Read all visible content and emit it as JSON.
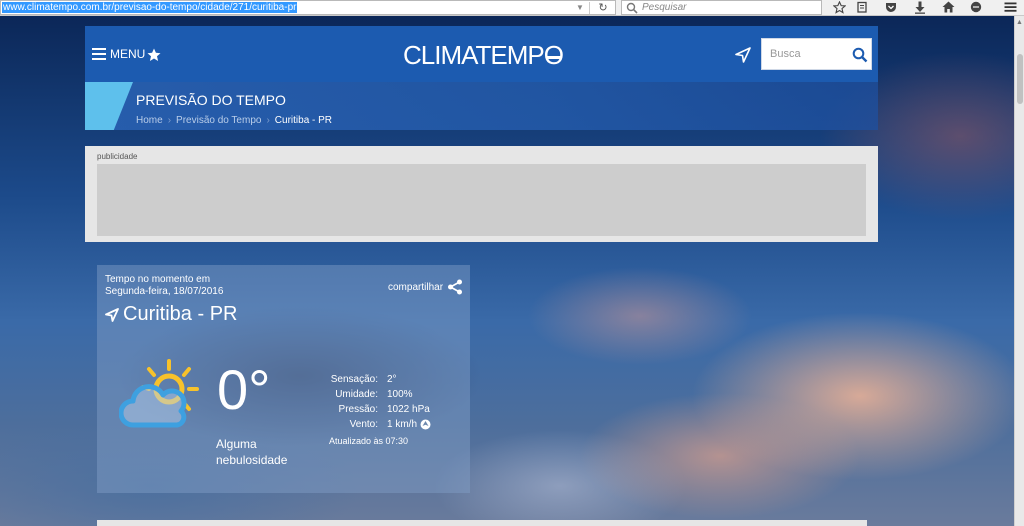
{
  "browser": {
    "url": "www.climatempo.com.br/previsao-do-tempo/cidade/271/curitiba-pr",
    "search_placeholder": "Pesquisar"
  },
  "header": {
    "menu_label": "MENU",
    "logo_text": "CLIMATEMPO",
    "search_placeholder": "Busca"
  },
  "title_band": {
    "title": "PREVISÃO DO TEMPO",
    "breadcrumb": [
      "Home",
      "Previsão do Tempo",
      "Curitiba - PR"
    ],
    "breadcrumb_separator": "›"
  },
  "ad": {
    "label": "publicidade"
  },
  "weather": {
    "intro_line1": "Tempo no momento em",
    "intro_line2": "Segunda-feira, 18/07/2016",
    "share_label": "compartilhar",
    "city": "Curitiba - PR",
    "temperature": "0°",
    "condition": "Alguma nebulosidade",
    "stats": [
      {
        "label": "Sensação:",
        "value": "2°"
      },
      {
        "label": "Umidade:",
        "value": "100%"
      },
      {
        "label": "Pressão:",
        "value": "1022 hPa"
      },
      {
        "label": "Vento:",
        "value": "1 km/h"
      }
    ],
    "updated": "Atualizado às 07:30"
  },
  "colors": {
    "header_blue": "#1c5bb0",
    "accent_cyan": "#5ec0ec",
    "sun_yellow": "#f7c22b",
    "cloud_blue": "#3ea0e0"
  },
  "icons": [
    "reload-icon",
    "search-icon",
    "bookmark-star-icon",
    "reading-list-icon",
    "pocket-icon",
    "download-icon",
    "home-icon",
    "chat-icon",
    "hamburger-menu-icon",
    "favorite-star-icon",
    "locate-icon",
    "share-icon",
    "sun-cloud-icon",
    "wind-direction-icon"
  ]
}
